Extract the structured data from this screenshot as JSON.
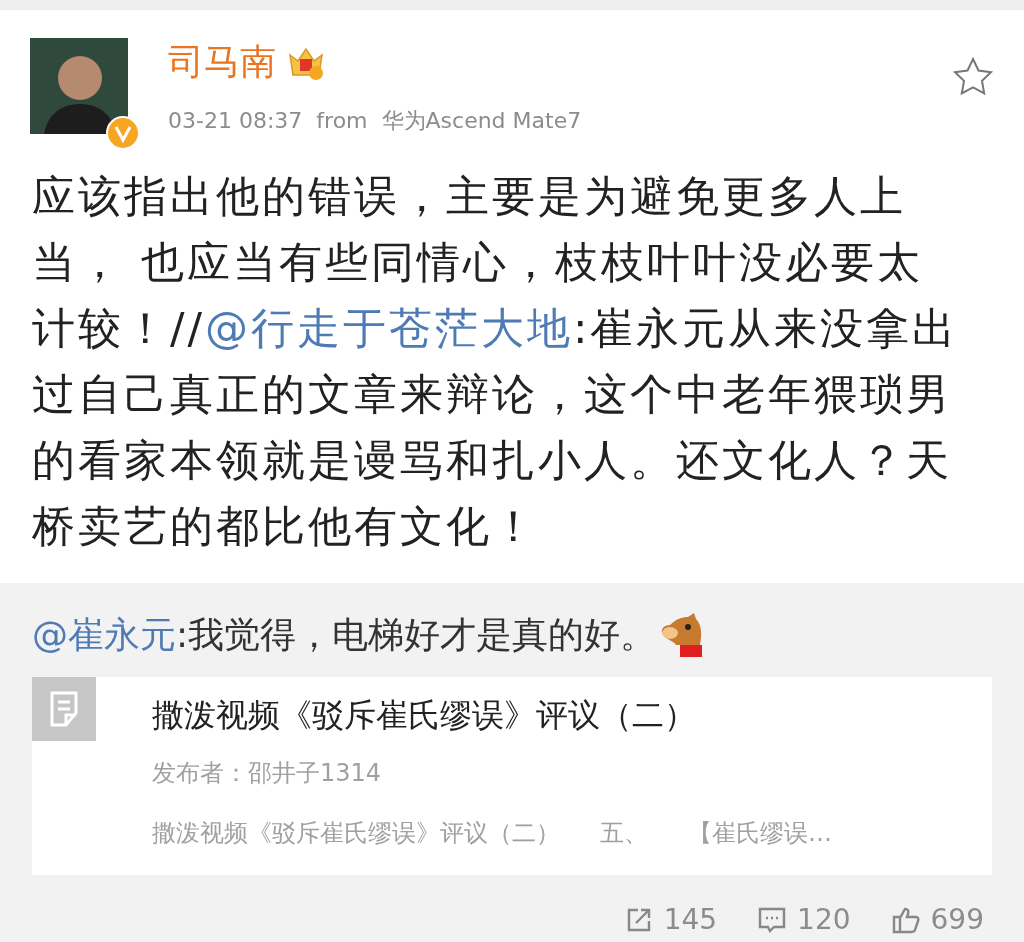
{
  "post": {
    "author": "司马南",
    "time": "03-21 08:37",
    "source_prefix": "from",
    "source": "华为Ascend Mate7",
    "verified": true,
    "starred": false,
    "text": [
      {
        "kind": "text",
        "text": "应该指出他的错误，主要是为避免更多人上当， 也应当有些同情心，枝枝叶叶没必要太计较！//"
      },
      {
        "kind": "mention",
        "text": "@行走于苍茫大地"
      },
      {
        "kind": "text",
        "text": ":崔永元从来没拿出过自己真正的文章来辩论，这个中老年猥琐男的看家本领就是谩骂和扎小人。还文化人？天桥卖艺的都比他有文化！"
      }
    ]
  },
  "retweet": {
    "mention": "@崔永元",
    "text": ":我觉得，电梯好才是真的好。",
    "card": {
      "title": "撒泼视频《驳斥崔氏缪误》评议（二）",
      "publisher": "发布者：邵井子1314",
      "excerpt": [
        "撒泼视频《驳斥崔氏缪误》评议（二）",
        "五、",
        "【崔氏缪误…"
      ]
    }
  },
  "actions": [
    {
      "kind": "repost",
      "count": "145"
    },
    {
      "kind": "comment",
      "count": "120"
    },
    {
      "kind": "like",
      "count": "699"
    }
  ]
}
